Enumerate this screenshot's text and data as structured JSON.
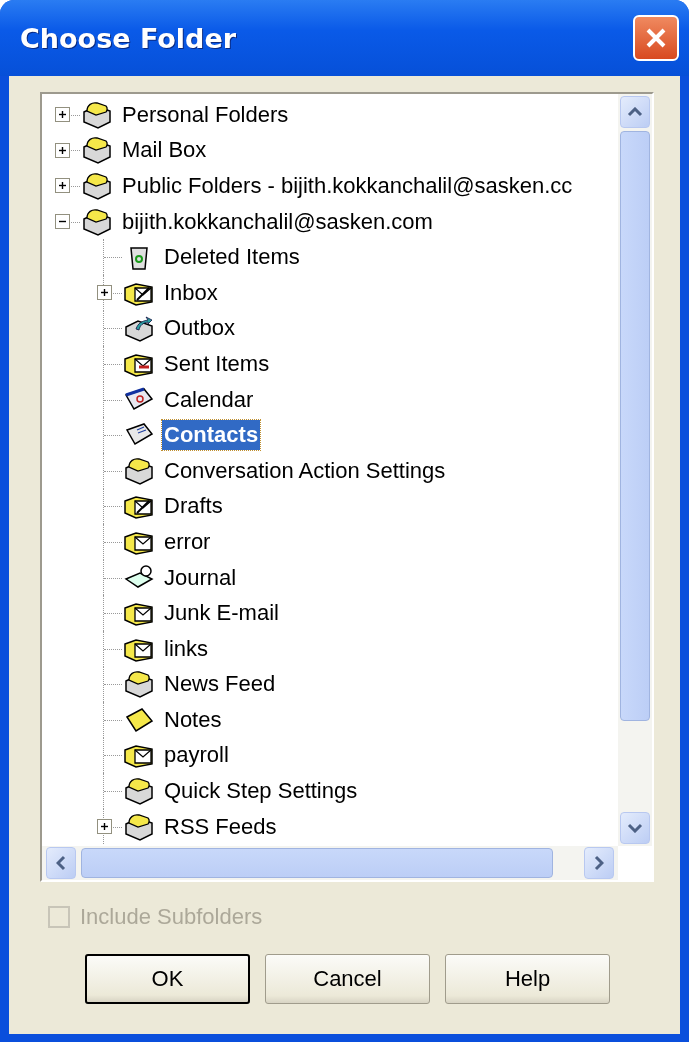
{
  "window": {
    "title": "Choose Folder"
  },
  "tree": [
    {
      "label": "Personal Folders",
      "kind": "store",
      "expanded": false,
      "selected": false
    },
    {
      "label": "Mail Box",
      "kind": "store",
      "expanded": false,
      "selected": false
    },
    {
      "label": "Public Folders - bijith.kokkanchalil@sasken.cc",
      "kind": "store",
      "expanded": false,
      "selected": false
    },
    {
      "label": "bijith.kokkanchalil@sasken.com",
      "kind": "store",
      "expanded": true,
      "selected": false,
      "children": [
        {
          "label": "Deleted Items",
          "kind": "deleted",
          "selected": false
        },
        {
          "label": "Inbox",
          "kind": "inbox",
          "expanded": false,
          "selected": false
        },
        {
          "label": "Outbox",
          "kind": "outbox",
          "selected": false
        },
        {
          "label": "Sent Items",
          "kind": "sent",
          "selected": false
        },
        {
          "label": "Calendar",
          "kind": "calendar",
          "selected": false
        },
        {
          "label": "Contacts",
          "kind": "contacts",
          "selected": true
        },
        {
          "label": "Conversation Action Settings",
          "kind": "store",
          "selected": false
        },
        {
          "label": "Drafts",
          "kind": "drafts",
          "selected": false
        },
        {
          "label": "error",
          "kind": "mail",
          "selected": false
        },
        {
          "label": "Journal",
          "kind": "journal",
          "selected": false
        },
        {
          "label": "Junk E-mail",
          "kind": "mail",
          "selected": false
        },
        {
          "label": "links",
          "kind": "mail",
          "selected": false
        },
        {
          "label": "News Feed",
          "kind": "store",
          "selected": false
        },
        {
          "label": "Notes",
          "kind": "notes",
          "selected": false
        },
        {
          "label": "payroll",
          "kind": "mail",
          "selected": false
        },
        {
          "label": "Quick Step Settings",
          "kind": "store",
          "selected": false
        },
        {
          "label": "RSS Feeds",
          "kind": "store",
          "expanded": false,
          "selected": false
        }
      ]
    }
  ],
  "include_subfolders": {
    "label": "Include Subfolders",
    "checked": false,
    "disabled": true
  },
  "buttons": [
    {
      "label": "OK",
      "default": true
    },
    {
      "label": "Cancel",
      "default": false
    },
    {
      "label": "Help",
      "default": false
    }
  ]
}
